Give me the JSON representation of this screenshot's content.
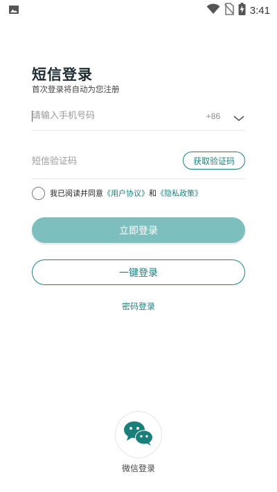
{
  "status_bar": {
    "time": "3:41",
    "icons": [
      "image-icon",
      "wifi-icon",
      "no-sim-icon",
      "battery-charging-icon"
    ]
  },
  "header": {
    "title": "短信登录",
    "subtitle": "首次登录将自动为您注册"
  },
  "phone": {
    "placeholder": "请输入手机号码",
    "value": "",
    "country_code": "+86"
  },
  "code": {
    "placeholder": "短信验证码",
    "value": "",
    "get_code_label": "获取验证码"
  },
  "agreement": {
    "checked": false,
    "prefix": "我已阅读并同意",
    "user_agreement": "《用户协议》",
    "and": "和",
    "privacy_policy": "《隐私政策》"
  },
  "actions": {
    "login_label": "立即登录",
    "one_key_label": "一键登录",
    "password_login_label": "密码登录"
  },
  "wechat": {
    "label": "微信登录"
  },
  "colors": {
    "accent": "#1f7e7c",
    "login_button_bg": "#7dbfbe",
    "wechat_green": "#1a7f7a"
  }
}
